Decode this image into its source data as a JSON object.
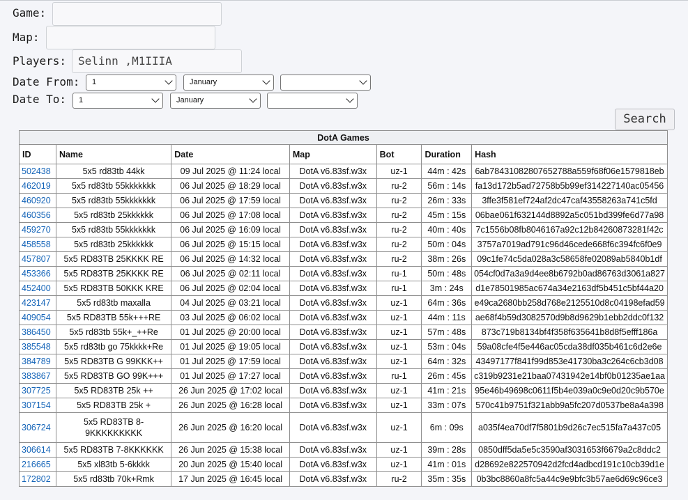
{
  "form": {
    "game_label": "Game:",
    "game_value": "",
    "map_label": "Map:",
    "map_value": "",
    "players_label": "Players:",
    "players_value": "Selinn ,M1IIIA",
    "date_from_label": "Date From:",
    "date_from": {
      "day": "1",
      "month": "January",
      "year": ""
    },
    "date_to_label": "Date To:",
    "date_to": {
      "day": "1",
      "month": "January",
      "year": ""
    },
    "search_label": "Search"
  },
  "table": {
    "caption": "DotA Games",
    "columns": [
      "ID",
      "Name",
      "Date",
      "Map",
      "Bot",
      "Duration",
      "Hash"
    ],
    "rows": [
      [
        "502438",
        "5x5 rd83tb 44kk",
        "09 Jul 2025 @ 11:24 local",
        "DotA v6.83sf.w3x",
        "uz-1",
        "44m : 42s",
        "6ab78431082807652788a559f68f06e1579818eb"
      ],
      [
        "462019",
        "5x5 rd83tb 55kkkkkkk",
        "06 Jul 2025 @ 18:29 local",
        "DotA v6.83sf.w3x",
        "ru-2",
        "56m : 14s",
        "fa13d172b5ad72758b5b99ef314227140ac05456"
      ],
      [
        "460920",
        "5x5 rd83tb 55kkkkkkk",
        "06 Jul 2025 @ 17:59 local",
        "DotA v6.83sf.w3x",
        "ru-2",
        "26m : 33s",
        "3ffe3f581ef724af2dc47caf43558263a741c5fd"
      ],
      [
        "460356",
        "5x5 rd83tb 25kkkkkk",
        "06 Jul 2025 @ 17:08 local",
        "DotA v6.83sf.w3x",
        "ru-2",
        "45m : 15s",
        "06bae061f632144d8892a5c051bd399fe6d77a98"
      ],
      [
        "459270",
        "5x5 rd83tb 55kkkkkkk",
        "06 Jul 2025 @ 16:09 local",
        "DotA v6.83sf.w3x",
        "ru-2",
        "40m : 40s",
        "7c1556b08fb8046167a92c12b84260873281f42c"
      ],
      [
        "458558",
        "5x5 rd83tb 25kkkkkk",
        "06 Jul 2025 @ 15:15 local",
        "DotA v6.83sf.w3x",
        "ru-2",
        "50m : 04s",
        "3757a7019ad791c96d46cede668f6c394fc6f0e9"
      ],
      [
        "457807",
        "5x5 RD83TB 25KKKK RE",
        "06 Jul 2025 @ 14:32 local",
        "DotA v6.83sf.w3x",
        "ru-2",
        "38m : 26s",
        "09c1fe74c5da028a3c58658fe02089ab5840b1df"
      ],
      [
        "453366",
        "5x5 RD83TB 25KKKK RE",
        "06 Jul 2025 @ 02:11 local",
        "DotA v6.83sf.w3x",
        "ru-1",
        "50m : 48s",
        "054cf0d7a3a9d4ee8b6792b0ad86763d3061a827"
      ],
      [
        "452400",
        "5x5 RD83TB 50KKK KRE",
        "06 Jul 2025 @ 02:04 local",
        "DotA v6.83sf.w3x",
        "ru-1",
        "3m : 24s",
        "d1e78501985ac674a34e2163df5b451c5bf44a20"
      ],
      [
        "423147",
        "5x5 rd83tb maxalla",
        "04 Jul 2025 @ 03:21 local",
        "DotA v6.83sf.w3x",
        "uz-1",
        "64m : 36s",
        "e49ca2680bb258d768e2125510d8c04198efad59"
      ],
      [
        "409054",
        "5x5 RD83TB 55k+++RE",
        "03 Jul 2025 @ 06:02 local",
        "DotA v6.83sf.w3x",
        "uz-1",
        "44m : 11s",
        "ae68f4b59d3082570d9b8d9629b1ebb2ddc0f132"
      ],
      [
        "386450",
        "5x5 rd83tb 55k+_++Re",
        "01 Jul 2025 @ 20:00 local",
        "DotA v6.83sf.w3x",
        "uz-1",
        "57m : 48s",
        "873c719b8134bf4f358f635641b8d8f5efff186a"
      ],
      [
        "385548",
        "5x5 rd83tb go 75kkkk+Re",
        "01 Jul 2025 @ 19:05 local",
        "DotA v6.83sf.w3x",
        "uz-1",
        "53m : 04s",
        "59a08cfe4f5e446ac05cda38df035b461c6d2e6e"
      ],
      [
        "384789",
        "5x5 RD83TB G 99KKK++",
        "01 Jul 2025 @ 17:59 local",
        "DotA v6.83sf.w3x",
        "uz-1",
        "64m : 32s",
        "43497177f841f99d853e41730ba3c264c6cb3d08"
      ],
      [
        "383867",
        "5x5 RD83TB GO 99K+++",
        "01 Jul 2025 @ 17:27 local",
        "DotA v6.83sf.w3x",
        "ru-1",
        "26m : 45s",
        "c319b9231e21baa07431942e14bf0b01235ae1aa"
      ],
      [
        "307725",
        "5x5 RD83TB 25k ++",
        "26 Jun 2025 @ 17:02 local",
        "DotA v6.83sf.w3x",
        "uz-1",
        "41m : 21s",
        "95e46b49698c0611f5b4e039a0c9e0d20c9b570e"
      ],
      [
        "307154",
        "5x5 RD83TB 25k +",
        "26 Jun 2025 @ 16:28 local",
        "DotA v6.83sf.w3x",
        "uz-1",
        "33m : 07s",
        "570c41b9751f321abb9a5fc207d0537be8a4a398"
      ],
      [
        "306724",
        "5x5 RD83TB 8-9KKKKKKKKK",
        "26 Jun 2025 @ 16:20 local",
        "DotA v6.83sf.w3x",
        "uz-1",
        "6m : 09s",
        "a035f4ea70df7f5801b9d26c7ec515fa7a437c05"
      ],
      [
        "306614",
        "5x5 RD83TB 7-8KKKKKK",
        "26 Jun 2025 @ 15:38 local",
        "DotA v6.83sf.w3x",
        "uz-1",
        "39m : 28s",
        "0850dff5da5e5c3590af3031653f6679a2c8ddc2"
      ],
      [
        "216665",
        "5x5 xl83tb 5-6kkkk",
        "20 Jun 2025 @ 15:40 local",
        "DotA v6.83sf.w3x",
        "uz-1",
        "41m : 01s",
        "d28692e822570942d2fcd4adbcd191c10cb39d1e"
      ],
      [
        "172802",
        "5x5 rd83tb 70k+Rmk",
        "17 Jun 2025 @ 16:45 local",
        "DotA v6.83sf.w3x",
        "ru-2",
        "35m : 35s",
        "0b3bc8860a8fc5a44c9e9bfc3b57ae6d69c96ce3"
      ]
    ]
  }
}
